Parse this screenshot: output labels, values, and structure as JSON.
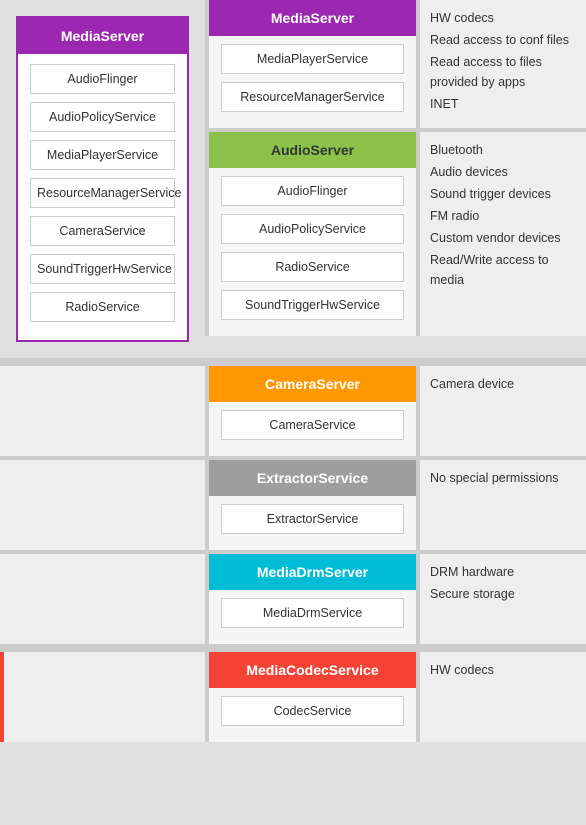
{
  "left": {
    "header": "MediaServer",
    "services": [
      "AudioFlinger",
      "AudioPolicyService",
      "MediaPlayerService",
      "ResourceManagerService",
      "CameraService",
      "SoundTriggerHwService",
      "RadioService"
    ]
  },
  "rows": [
    {
      "id": "media-server",
      "header": "MediaServer",
      "headerClass": "media-server",
      "services": [
        "MediaPlayerService",
        "ResourceManagerService"
      ],
      "permissions": [
        "HW codecs",
        "Read access to conf files",
        "Read access to files provided by apps",
        "INET"
      ]
    },
    {
      "id": "audio-server",
      "header": "AudioServer",
      "headerClass": "audio-server",
      "services": [
        "AudioFlinger",
        "AudioPolicyService",
        "RadioService",
        "SoundTriggerHwService"
      ],
      "permissions": [
        "Bluetooth",
        "Audio devices",
        "Sound trigger devices",
        "FM radio",
        "Custom vendor devices",
        "Read/Write access to media"
      ]
    },
    {
      "id": "camera-server",
      "header": "CameraServer",
      "headerClass": "camera-server",
      "services": [
        "CameraService"
      ],
      "permissions": [
        "Camera device"
      ]
    },
    {
      "id": "extractor-service",
      "header": "ExtractorService",
      "headerClass": "extractor-service",
      "services": [
        "ExtractorService"
      ],
      "permissions": [
        "No special permissions"
      ]
    },
    {
      "id": "media-drm-server",
      "header": "MediaDrmServer",
      "headerClass": "media-drm-server",
      "services": [
        "MediaDrmService"
      ],
      "permissions": [
        "DRM hardware",
        "Secure storage"
      ]
    },
    {
      "id": "media-codec-service",
      "header": "MediaCodecService",
      "headerClass": "media-codec-service",
      "services": [
        "CodecService"
      ],
      "permissions": [
        "HW codecs"
      ]
    }
  ]
}
